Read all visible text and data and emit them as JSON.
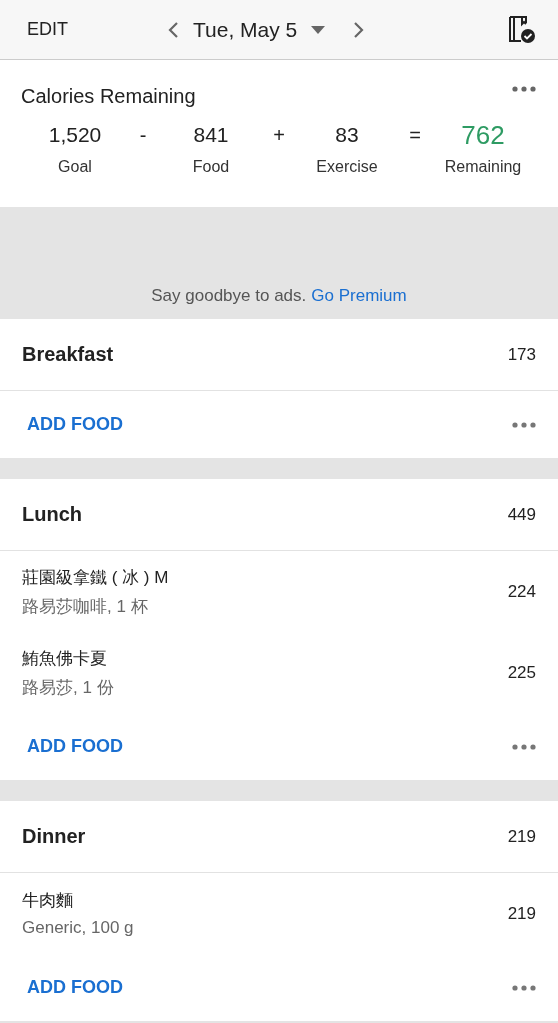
{
  "header": {
    "edit": "EDIT",
    "date": "Tue, May 5"
  },
  "summary": {
    "title": "Calories Remaining",
    "terms": [
      {
        "value": "1,520",
        "label": "Goal"
      },
      {
        "value": "841",
        "label": "Food"
      },
      {
        "value": "83",
        "label": "Exercise"
      },
      {
        "value": "762",
        "label": "Remaining"
      }
    ],
    "operators": [
      "-",
      "+",
      "="
    ]
  },
  "ad": {
    "text": "Say goodbye to ads.",
    "link": "Go Premium"
  },
  "meals": [
    {
      "name": "Breakfast",
      "calories": "173",
      "add_label": "ADD FOOD"
    },
    {
      "name": "Lunch",
      "calories": "449",
      "items": [
        {
          "name": "莊園級拿鐵 ( 冰 ) M",
          "detail": "路易莎咖啡, 1 杯",
          "calories": "224"
        },
        {
          "name": "鮪魚佛卡夏",
          "detail": "路易莎, 1 份",
          "calories": "225"
        }
      ],
      "add_label": "ADD FOOD"
    },
    {
      "name": "Dinner",
      "calories": "219",
      "items": [
        {
          "name": "牛肉麵",
          "detail": "Generic, 100 g",
          "calories": "219"
        }
      ],
      "add_label": "ADD FOOD"
    }
  ]
}
